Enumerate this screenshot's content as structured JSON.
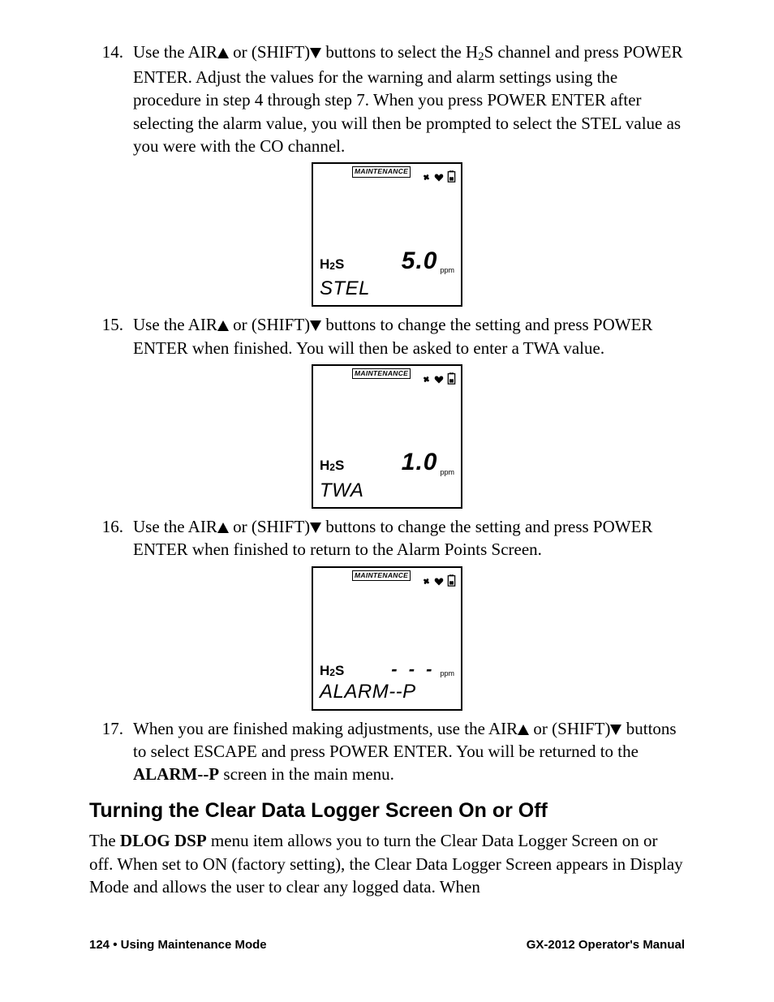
{
  "steps": {
    "s14": {
      "num": "14.",
      "text_before": "Use the AIR",
      "text_mid1": " or (SHIFT)",
      "text_mid2": " buttons to select the H",
      "text_after": "S channel and press POWER ENTER. Adjust the values for the warning and alarm settings using the procedure in step 4 through step 7. When you press POWER ENTER after selecting the alarm value, you will then be prompted to select the STEL value as you were with the CO channel."
    },
    "s15": {
      "num": "15.",
      "text_before": "Use the AIR",
      "text_mid1": " or (SHIFT)",
      "text_after": " buttons to change the setting and press POWER ENTER when finished. You will then be asked to enter a TWA value."
    },
    "s16": {
      "num": "16.",
      "text_before": "Use the AIR",
      "text_mid1": " or (SHIFT)",
      "text_after": " buttons to change the setting and press POWER ENTER when finished to return to the Alarm Points Screen."
    },
    "s17": {
      "num": "17.",
      "text_before": "When you are finished making adjustments, use the AIR",
      "text_mid1": " or (SHIFT)",
      "text_mid2": " buttons to select ESCAPE and press POWER ENTER. You will be returned to the ",
      "bold": "ALARM--P",
      "text_after": " screen in the main menu."
    }
  },
  "screens": {
    "common": {
      "maint": "MAINTENANCE",
      "gas": "H",
      "gas_sub": "2",
      "gas_suffix": "S",
      "unit": "ppm"
    },
    "a": {
      "value": "5.0",
      "label": "STEL"
    },
    "b": {
      "value": "1.0",
      "label": "TWA"
    },
    "c": {
      "value": "- - -",
      "label": "ALARM--P"
    }
  },
  "sectionHeading": "Turning the Clear Data Logger Screen On or Off",
  "sectionBody": {
    "pre": "The ",
    "bold": "DLOG DSP",
    "post": " menu item allows you to turn the Clear Data Logger Screen on or off. When set to ON (factory setting), the Clear Data Logger Screen appears in Display Mode and allows the user to clear any logged data. When"
  },
  "footer": {
    "left": "124 • Using Maintenance Mode",
    "right": "GX-2012 Operator's Manual"
  }
}
